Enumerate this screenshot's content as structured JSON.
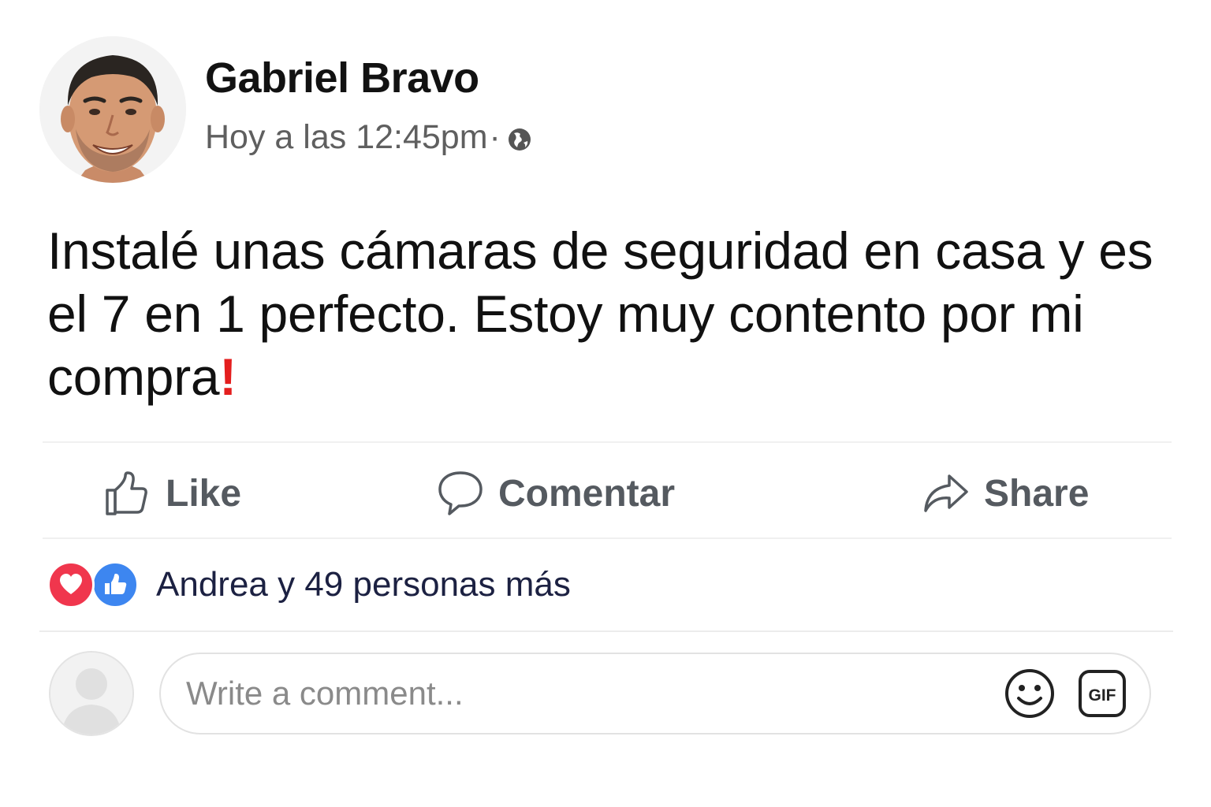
{
  "post": {
    "author": "Gabriel Bravo",
    "timestamp": "Hoy a las 12:45pm",
    "separator": "·",
    "privacy_icon": "globe-icon",
    "text": "Instalé unas cámaras de seguridad en casa y es el 7 en 1 perfecto. Estoy muy contento por mi compra",
    "text_end_mark": "!",
    "text_end_mark_color": "#e41e1e"
  },
  "actions": {
    "like_label": "Like",
    "comment_label": "Comentar",
    "share_label": "Share"
  },
  "reactions": {
    "icons": [
      "heart-icon",
      "thumbs-up-icon"
    ],
    "summary": "Andrea y 49 personas más"
  },
  "composer": {
    "placeholder": "Write a comment...",
    "emoji_icon": "smiley-icon",
    "gif_label": "GIF"
  },
  "colors": {
    "love": "#f0364d",
    "like": "#3d86f0",
    "action_text": "#555a60"
  }
}
